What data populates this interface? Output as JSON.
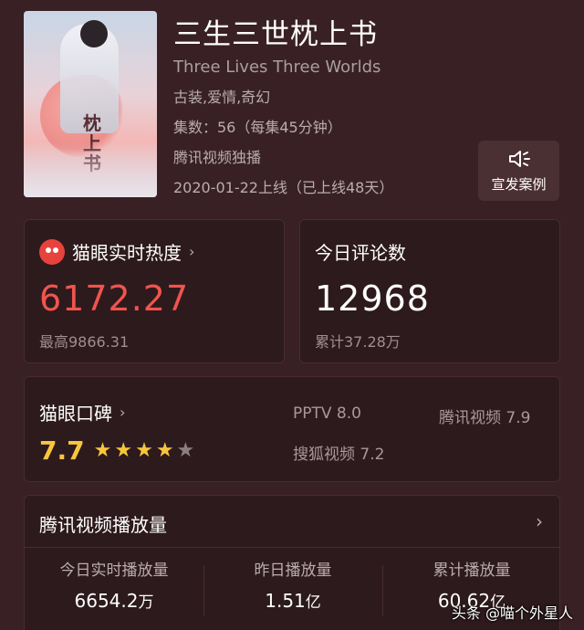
{
  "show": {
    "poster_text": "枕上书",
    "title": "三生三世枕上书",
    "en_title": "Three Lives Three Worlds",
    "genres": "古装,爱情,奇幻",
    "episodes": "集数：56（每集45分钟）",
    "platform_note": "腾讯视频独播",
    "release": "2020-01-22上线（已上线48天）"
  },
  "promo": {
    "label": "宣发案例",
    "icon": "speaker-icon"
  },
  "heat_card": {
    "title": "猫眼实时热度",
    "value": "6172.27",
    "peak": "最高9866.31",
    "accent": "#f0544e",
    "icon": "maoyan-cat-logo-icon"
  },
  "comments_card": {
    "title": "今日评论数",
    "value": "12968",
    "total": "累计37.28万"
  },
  "rating_card": {
    "title": "猫眼口碑",
    "score": "7.7",
    "stars_filled": 4,
    "stars_total": 5,
    "star_color": "#f7c63e",
    "platforms": [
      {
        "text": "PPTV  8.0"
      },
      {
        "text": "腾讯视频  7.9"
      },
      {
        "text": "搜狐视频  7.2"
      }
    ]
  },
  "plays_card": {
    "title": "腾讯视频播放量",
    "stats": [
      {
        "label": "今日实时播放量",
        "value": "6654.2",
        "unit": "万"
      },
      {
        "label": "昨日播放量",
        "value": "1.51",
        "unit": "亿"
      },
      {
        "label": "累计播放量",
        "value": "60.62",
        "unit": "亿"
      }
    ]
  },
  "watermark": "头条 @喵个外星人"
}
